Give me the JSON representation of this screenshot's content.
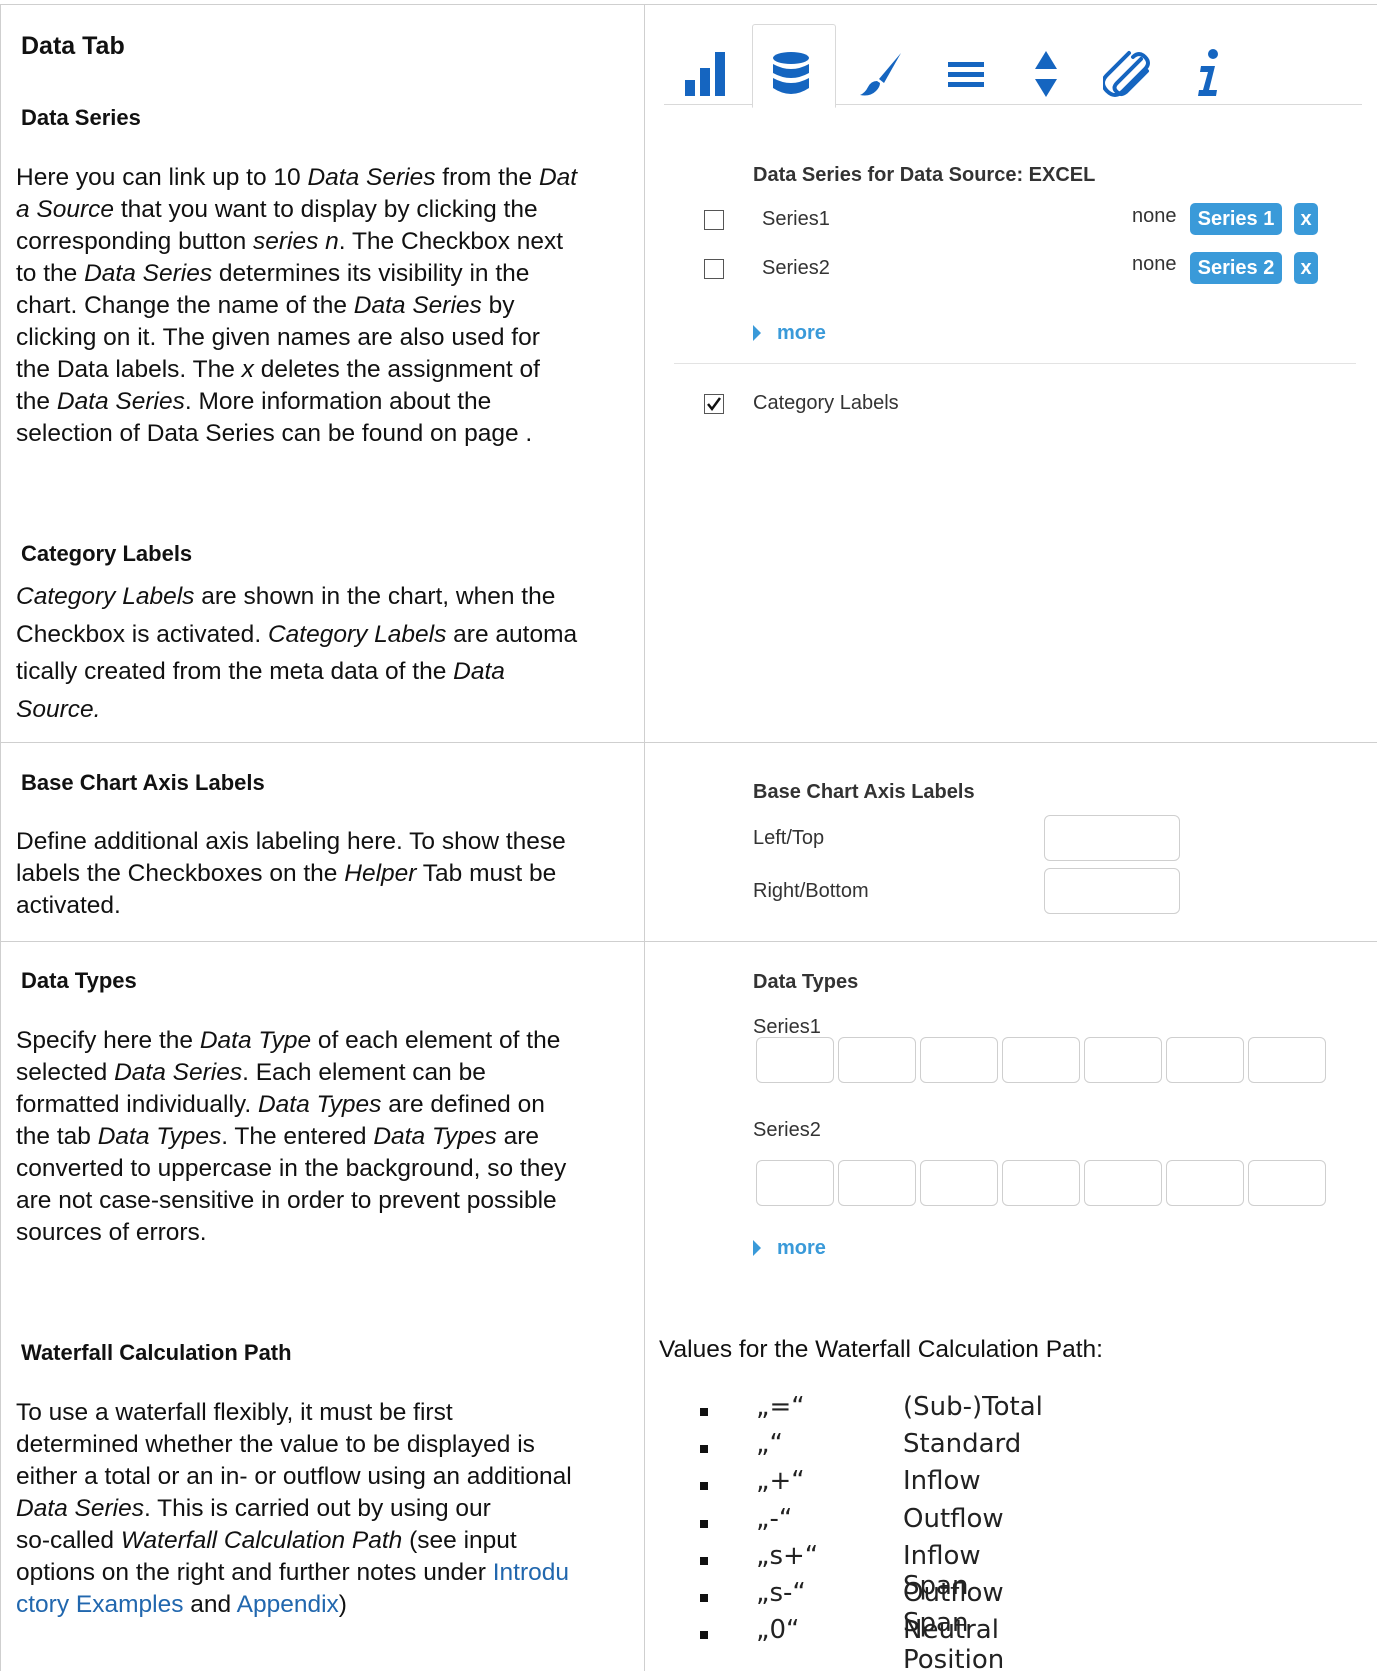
{
  "left": {
    "page_title": "Data Tab",
    "data_series": {
      "title": "Data Series",
      "lines": [
        [
          "Here you can link up to 10 ",
          {
            "i": "Data Series"
          },
          " from the ",
          {
            "i": "Dat"
          }
        ],
        [
          {
            "i": "a Source"
          },
          " that you want to display by clicking the"
        ],
        [
          "corresponding button ",
          {
            "i": "series n"
          },
          ". The Checkbox next"
        ],
        [
          "to the ",
          {
            "i": "Data Series"
          },
          " determines its visibility in the"
        ],
        [
          "chart. Change the name of the ",
          {
            "i": "Data Series"
          },
          " by"
        ],
        [
          "clicking on it. The given names are also used for"
        ],
        [
          "the Data labels. The ",
          {
            "i": "x"
          },
          " deletes the assignment of"
        ],
        [
          "the ",
          {
            "i": "Data Series"
          },
          ". More information about the"
        ],
        [
          "selection of Data Series can be found on page ."
        ]
      ]
    },
    "category_labels": {
      "title": "Category Labels",
      "lines": [
        [
          {
            "i": "Category Labels"
          },
          " are shown in the chart, when the"
        ],
        [
          "Checkbox is activated. ",
          {
            "i": "Category Labels"
          },
          " are automa"
        ],
        [
          "tically created from the meta data of the ",
          {
            "i": "Data"
          }
        ],
        [
          {
            "i": "Source."
          }
        ]
      ]
    },
    "base_axis": {
      "title": "Base Chart Axis Labels",
      "lines": [
        [
          "Define additional axis labeling here. To show these"
        ],
        [
          "labels the Checkboxes on the ",
          {
            "i": "Helper"
          },
          " Tab must be"
        ],
        [
          "activated."
        ]
      ]
    },
    "data_types": {
      "title": "Data Types",
      "lines": [
        [
          "Specify here the ",
          {
            "i": "Data Type"
          },
          " of each element of the"
        ],
        [
          "selected ",
          {
            "i": "Data Series"
          },
          ". Each element can be"
        ],
        [
          "formatted individually. ",
          {
            "i": "Data Types"
          },
          " are defined on"
        ],
        [
          "the tab ",
          {
            "i": "Data Types"
          },
          ". The entered ",
          {
            "i": "Data Types"
          },
          " are"
        ],
        [
          "converted to uppercase in the background, so they"
        ],
        [
          "are not case-sensitive in order to prevent possible"
        ],
        [
          "sources of errors."
        ]
      ]
    },
    "waterfall": {
      "title": "Waterfall Calculation Path",
      "lines": [
        [
          "To use a waterfall flexibly, it must be first"
        ],
        [
          "determined whether the value to be displayed is"
        ],
        [
          "either a total or an in- or outflow using an additional"
        ],
        [
          {
            "i": "Data Series"
          },
          ". This is carried out by using our"
        ],
        [
          "so-called ",
          {
            "i": "Waterfall Calculation Path"
          },
          " (see input"
        ],
        [
          "options on the right and further notes under ",
          {
            "a": "Introdu"
          }
        ],
        [
          {
            "a": "ctory Examples"
          },
          " and ",
          {
            "a": "Appendix"
          },
          ")"
        ]
      ]
    }
  },
  "right": {
    "tabs": [
      "bar-chart-icon",
      "database-icon",
      "brush-icon",
      "menu-lines-icon",
      "sort-arrows-icon",
      "paperclip-icon",
      "info-icon"
    ],
    "series_header": "Data Series for Data Source: EXCEL",
    "series": [
      {
        "name": "Series1",
        "checked": false,
        "status": "none",
        "button": "Series 1",
        "remove": "x"
      },
      {
        "name": "Series2",
        "checked": false,
        "status": "none",
        "button": "Series 2",
        "remove": "x"
      }
    ],
    "more_label": "more",
    "category_labels": {
      "label": "Category Labels",
      "checked": true
    },
    "axis": {
      "title": "Base Chart Axis Labels",
      "left_top": "Left/Top",
      "right_bottom": "Right/Bottom"
    },
    "data_types": {
      "title": "Data Types",
      "series": [
        "Series1",
        "Series2"
      ],
      "more_label": "more"
    },
    "waterfall": {
      "intro": "Values for the Waterfall Calculation Path:",
      "items": [
        {
          "value": "„=“",
          "desc": "(Sub-)Total"
        },
        {
          "value": "„“",
          "desc": "Standard"
        },
        {
          "value": "„+“",
          "desc": "Inflow"
        },
        {
          "value": "„-“",
          "desc": "Outflow"
        },
        {
          "value": "„s+“",
          "desc": "Inflow Span"
        },
        {
          "value": "„s-“",
          "desc": "Outflow Span"
        },
        {
          "value": "„0“",
          "desc": "Neutral Position"
        }
      ]
    },
    "colors": {
      "accent": "#3a9ad9",
      "icon": "#1565c0",
      "link": "#2167ae"
    }
  }
}
